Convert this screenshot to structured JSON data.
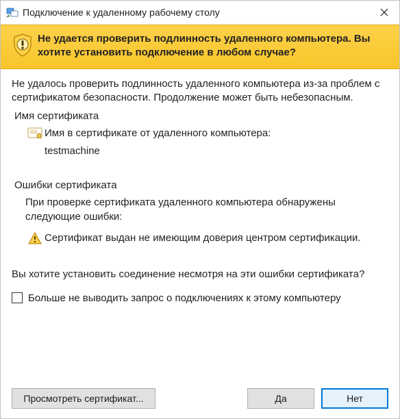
{
  "titlebar": {
    "title": "Подключение к удаленному рабочему столу"
  },
  "banner": {
    "text": "Не удается проверить подлинность удаленного компьютера. Вы хотите установить подключение в любом случае?"
  },
  "body": {
    "explain": "Не удалось проверить подлинность удаленного компьютера из-за проблем с сертификатом безопасности. Продолжение может быть небезопасным.",
    "cert_name_label": "Имя сертификата",
    "cert_name_caption": "Имя в сертификате от удаленного компьютера:",
    "cert_name_value": "testmachine",
    "cert_errors_label": "Ошибки сертификата",
    "cert_errors_intro": "При проверке сертификата удаленного компьютера обнаружены следующие ошибки:",
    "cert_error_1": "Сертификат выдан не имеющим доверия центром сертификации.",
    "proceed_question": "Вы хотите установить соединение несмотря на эти ошибки сертификата?",
    "dont_ask_label": "Больше не выводить запрос о подключениях к этому компьютеру"
  },
  "buttons": {
    "view_cert": "Просмотреть сертификат...",
    "yes": "Да",
    "no": "Нет"
  }
}
